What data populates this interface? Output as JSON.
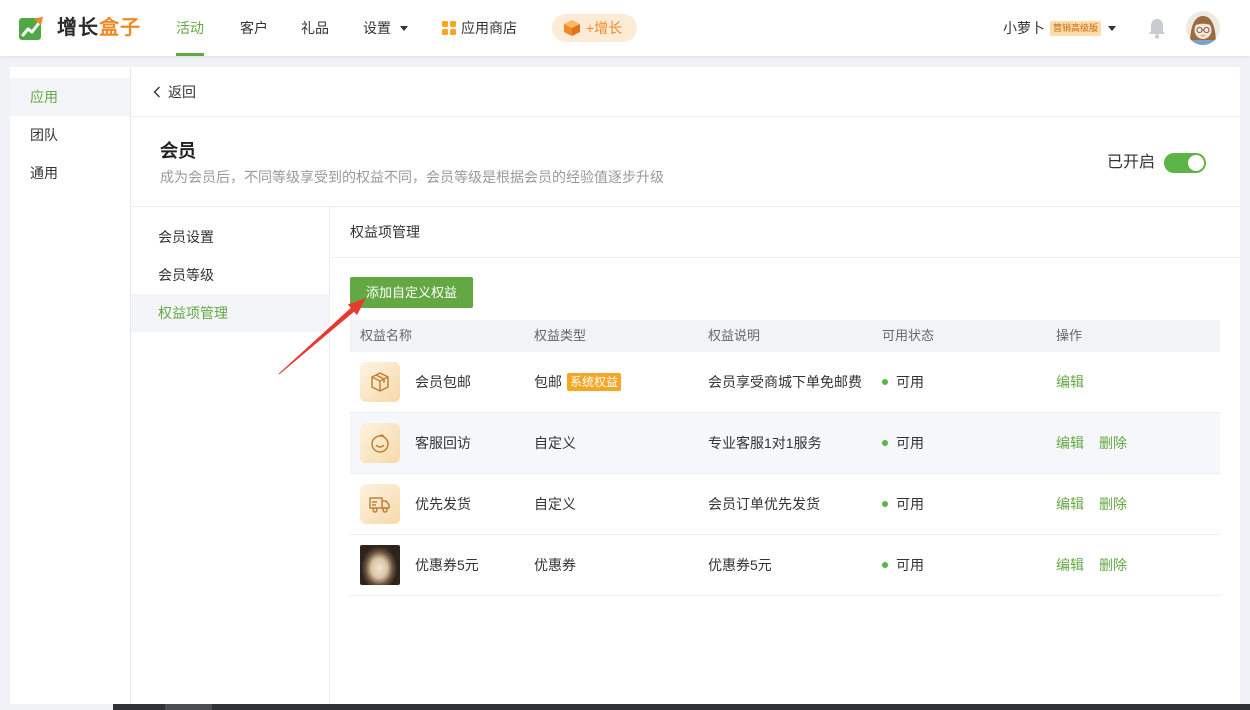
{
  "colors": {
    "primary": "#64a843",
    "accent": "#f08a24",
    "badge": "#f5a623",
    "toggle": "#5cb346",
    "annotation": "#e53a2f"
  },
  "brand": {
    "icon": "logo-icon",
    "name_part1": "增长",
    "name_part2": "盒子"
  },
  "topnav": {
    "items": [
      {
        "label": "活动",
        "active": true
      },
      {
        "label": "客户",
        "active": false
      },
      {
        "label": "礼品",
        "active": false
      },
      {
        "label": "设置",
        "active": false,
        "icon": "caret-down-icon"
      },
      {
        "label": "应用商店",
        "active": false,
        "icon": "app-grid-icon"
      }
    ],
    "growth_button": {
      "label": "+增长",
      "icon": "cube-icon"
    }
  },
  "user": {
    "name": "小萝卜",
    "plan_badge": "营销高级版",
    "dropdown_icon": "caret-down-icon",
    "notification_icon": "bell-icon",
    "avatar_icon": "user-avatar"
  },
  "sidebar": {
    "items": [
      {
        "label": "应用",
        "active": true
      },
      {
        "label": "团队",
        "active": false
      },
      {
        "label": "通用",
        "active": false
      }
    ]
  },
  "page": {
    "back_icon": "chevron-left-icon",
    "back_label": "返回",
    "title": "会员",
    "subtitle": "成为会员后，不同等级享受到的权益不同，会员等级是根据会员的经验值逐步升级",
    "status_label": "已开启",
    "enabled": true
  },
  "subnav": {
    "items": [
      {
        "label": "会员设置",
        "active": false
      },
      {
        "label": "会员等级",
        "active": false
      },
      {
        "label": "权益项管理",
        "active": true
      }
    ]
  },
  "benefits": {
    "title": "权益项管理",
    "add_button_label": "添加自定义权益",
    "columns": [
      "权益名称",
      "权益类型",
      "权益说明",
      "可用状态",
      "操作"
    ],
    "rows": [
      {
        "icon": "package-icon",
        "name": "会员包邮",
        "type": "包邮",
        "type_badge": "系统权益",
        "description": "会员享受商城下单免邮费",
        "status": "可用",
        "actions": [
          "编辑"
        ],
        "highlighted": false
      },
      {
        "icon": "smile-icon",
        "name": "客服回访",
        "type": "自定义",
        "description": "专业客服1对1服务",
        "status": "可用",
        "actions": [
          "编辑",
          "删除"
        ],
        "highlighted": true
      },
      {
        "icon": "truck-icon",
        "name": "优先发货",
        "type": "自定义",
        "description": "会员订单优先发货",
        "status": "可用",
        "actions": [
          "编辑",
          "删除"
        ],
        "highlighted": false
      },
      {
        "icon": "photo-thumbnail",
        "name": "优惠券5元",
        "type": "优惠券",
        "description": "优惠券5元",
        "status": "可用",
        "actions": [
          "编辑",
          "删除"
        ],
        "highlighted": false
      }
    ]
  }
}
